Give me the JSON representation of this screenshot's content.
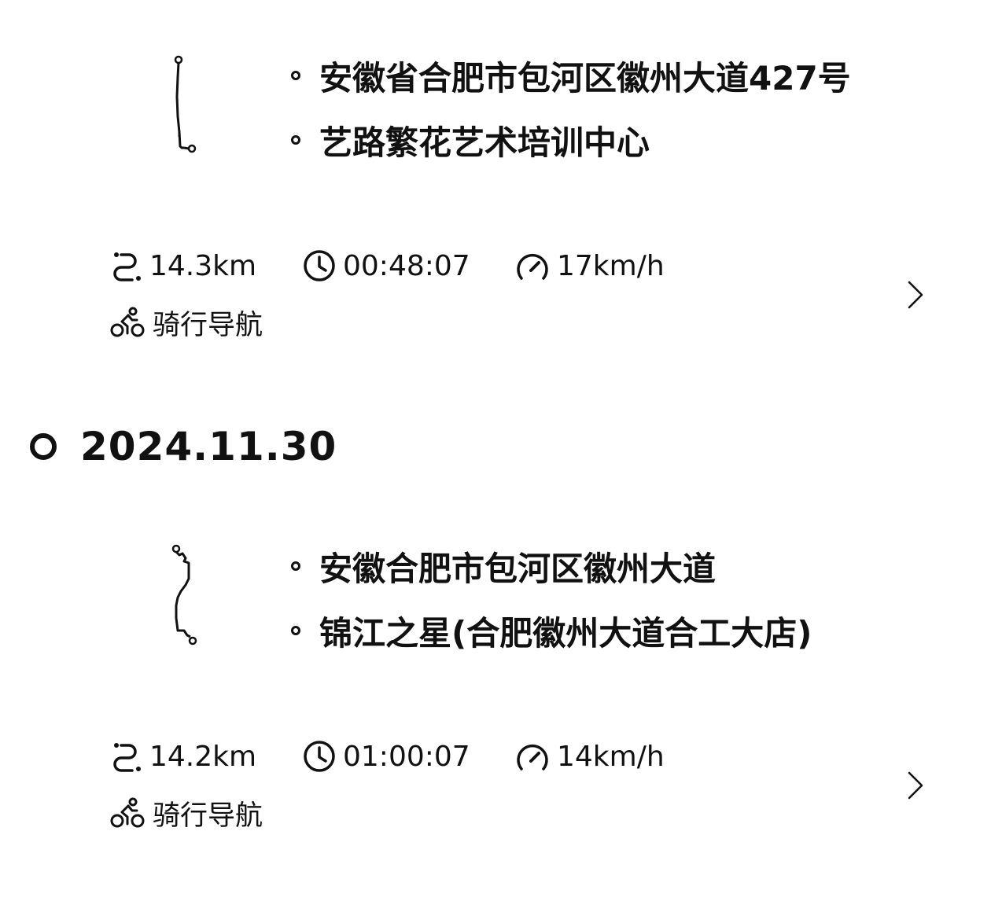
{
  "trips": [
    {
      "start": "安徽省合肥市包河区徽州大道427号",
      "end": "艺路繁花艺术培训中心",
      "distance": "14.3km",
      "duration": "00:48:07",
      "speed": "17km/h",
      "mode": "骑行导航",
      "route_icon": "route-thumbnail"
    },
    {
      "start": "安徽合肥市包河区徽州大道",
      "end": "锦江之星(合肥徽州大道合工大店)",
      "distance": "14.2km",
      "duration": "01:00:07",
      "speed": "14km/h",
      "mode": "骑行导航",
      "route_icon": "route-thumbnail"
    }
  ],
  "date_header": "2024.11.30",
  "icons": {
    "distance": "route-distance-icon",
    "duration": "clock-icon",
    "speed": "speedometer-icon",
    "mode": "bicycle-icon",
    "open": "chevron-right-icon"
  }
}
